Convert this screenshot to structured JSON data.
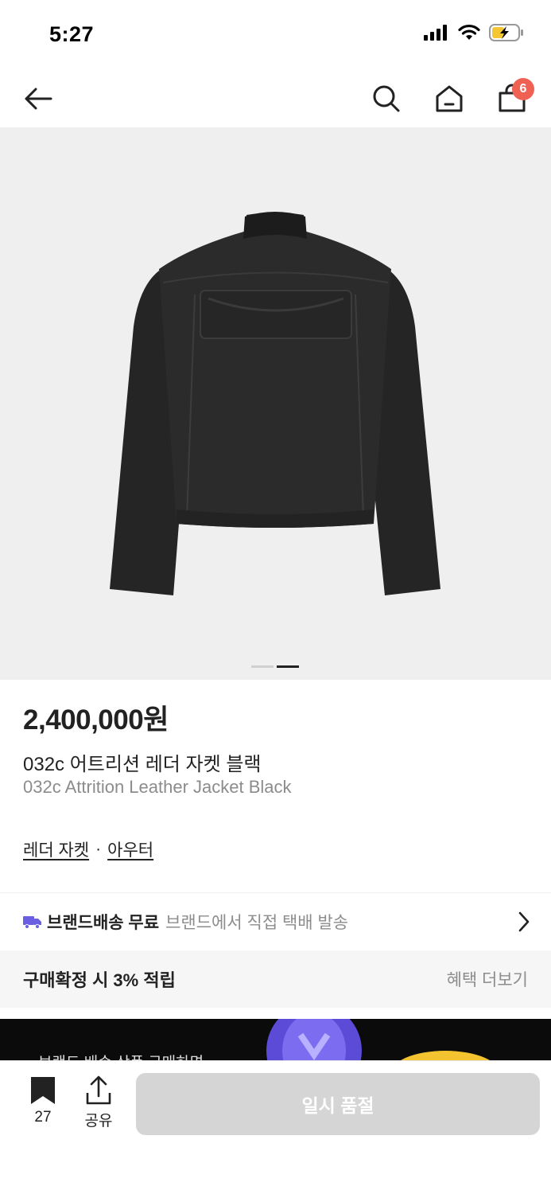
{
  "status_bar": {
    "time": "5:27"
  },
  "nav": {
    "cart_count": "6"
  },
  "gallery": {
    "page_count": 2,
    "active_page": 2
  },
  "product": {
    "price": "2,400,000원",
    "name_ko": "032c 어트리션 레더 자켓 블랙",
    "name_en": "032c Attrition Leather Jacket Black",
    "category_1": "레더 자켓",
    "separator": "·",
    "category_2": "아우터"
  },
  "shipping": {
    "title": "브랜드배송 무료",
    "desc": "브랜드에서 직접 택배 발송"
  },
  "points": {
    "title": "구매확정 시 3% 적립",
    "more": "혜택 더보기"
  },
  "banner": {
    "text": "브랜드 배송 상품 구매하면"
  },
  "bottom": {
    "bookmark_count": "27",
    "share_label": "공유",
    "soldout_label": "일시 품절"
  },
  "colors": {
    "badge": "#ef6253",
    "shipping_truck": "#6a5fe0",
    "button_disabled": "#d5d5d5"
  }
}
